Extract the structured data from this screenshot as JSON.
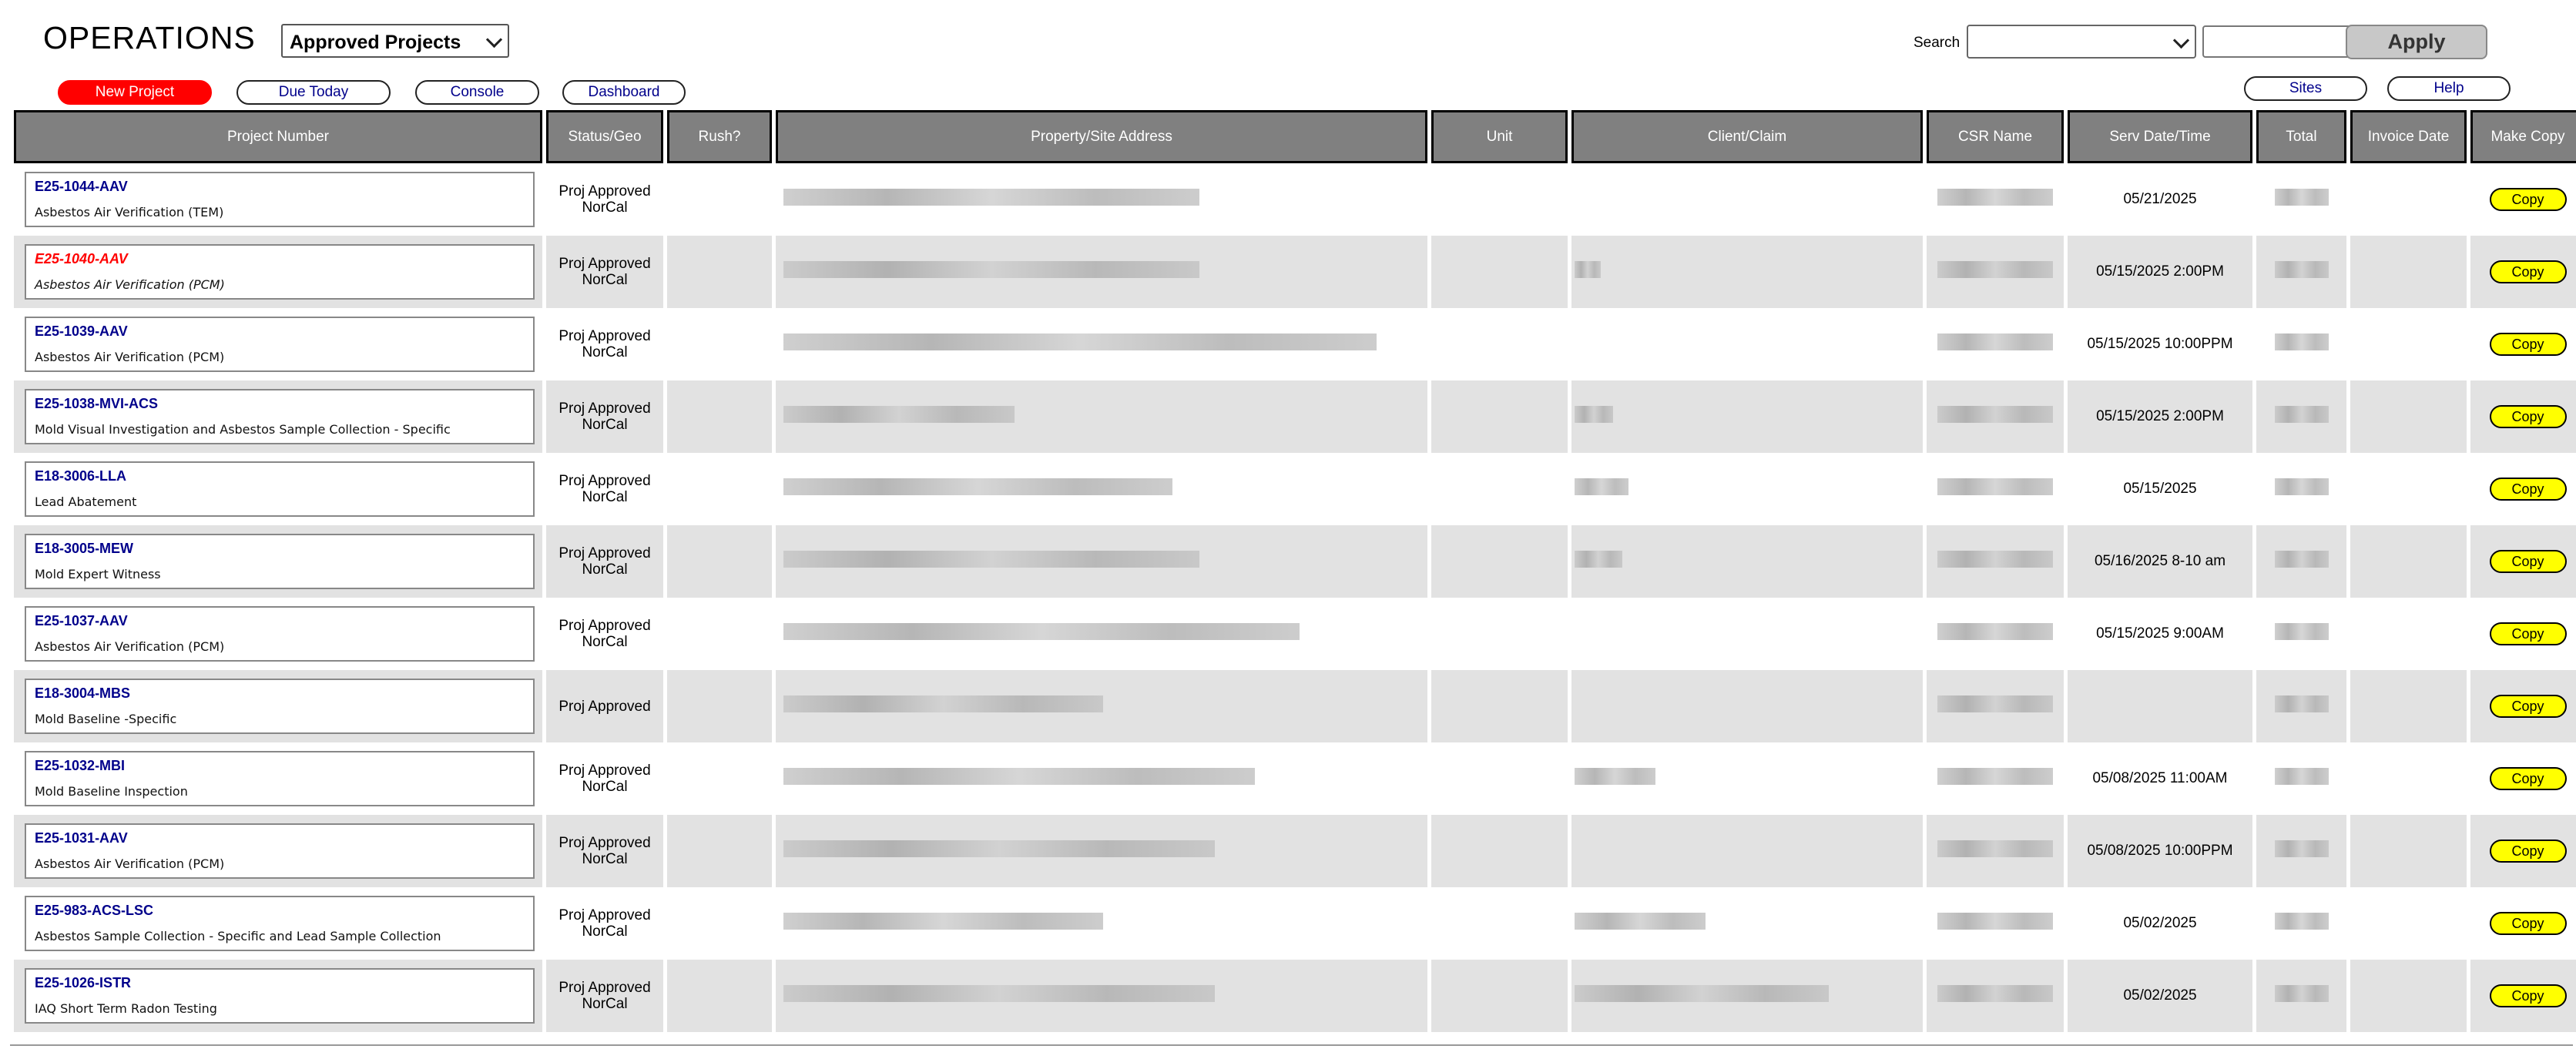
{
  "header": {
    "title": "OPERATIONS",
    "view_select": "Approved Projects",
    "search_label": "Search",
    "apply_label": "Apply"
  },
  "nav": {
    "new_project": "New Project",
    "due_today": "Due Today",
    "console": "Console",
    "dashboard": "Dashboard",
    "sites": "Sites",
    "help": "Help"
  },
  "table": {
    "columns": [
      "Project Number",
      "Status/Geo",
      "Rush?",
      "Property/Site Address",
      "Unit",
      "Client/Claim",
      "CSR Name",
      "Serv Date/Time",
      "Total",
      "Invoice Date",
      "Make Copy"
    ],
    "copy_label": "Copy",
    "rows": [
      {
        "number": "E25-1044-AAV",
        "desc": "Asbestos Air Verification (TEM)",
        "status": "Proj Approved",
        "geo": "NorCal",
        "date": "05/21/2025",
        "flag": false
      },
      {
        "number": "E25-1040-AAV",
        "desc": "Asbestos Air Verification (PCM)",
        "status": "Proj Approved",
        "geo": "NorCal",
        "date": "05/15/2025  2:00PM",
        "flag": true
      },
      {
        "number": "E25-1039-AAV",
        "desc": "Asbestos Air Verification (PCM)",
        "status": "Proj Approved",
        "geo": "NorCal",
        "date": "05/15/2025  10:00PPM",
        "flag": false
      },
      {
        "number": "E25-1038-MVI-ACS",
        "desc": "Mold Visual Investigation and Asbestos Sample Collection - Specific",
        "status": "Proj Approved",
        "geo": "NorCal",
        "date": "05/15/2025  2:00PM",
        "flag": false
      },
      {
        "number": "E18-3006-LLA",
        "desc": "Lead Abatement",
        "status": "Proj Approved",
        "geo": "NorCal",
        "date": "05/15/2025",
        "flag": false
      },
      {
        "number": "E18-3005-MEW",
        "desc": "Mold Expert Witness",
        "status": "Proj Approved",
        "geo": "NorCal",
        "date": "05/16/2025  8-10 am",
        "flag": false
      },
      {
        "number": "E25-1037-AAV",
        "desc": "Asbestos Air Verification (PCM)",
        "status": "Proj Approved",
        "geo": "NorCal",
        "date": "05/15/2025  9:00AM",
        "flag": false
      },
      {
        "number": "E18-3004-MBS",
        "desc": "Mold Baseline -Specific",
        "status": "Proj Approved",
        "geo": "",
        "date": "",
        "flag": false
      },
      {
        "number": "E25-1032-MBI",
        "desc": "Mold Baseline Inspection",
        "status": "Proj Approved",
        "geo": "NorCal",
        "date": "05/08/2025  11:00AM",
        "flag": false
      },
      {
        "number": "E25-1031-AAV",
        "desc": "Asbestos Air Verification (PCM)",
        "status": "Proj Approved",
        "geo": "NorCal",
        "date": "05/08/2025  10:00PPM",
        "flag": false
      },
      {
        "number": "E25-983-ACS-LSC",
        "desc": "Asbestos Sample Collection - Specific and Lead Sample Collection",
        "status": "Proj Approved",
        "geo": "NorCal",
        "date": "05/02/2025",
        "flag": false
      },
      {
        "number": "E25-1026-ISTR",
        "desc": "IAQ Short Term Radon Testing",
        "status": "Proj Approved",
        "geo": "NorCal",
        "date": "05/02/2025",
        "flag": false
      }
    ]
  }
}
